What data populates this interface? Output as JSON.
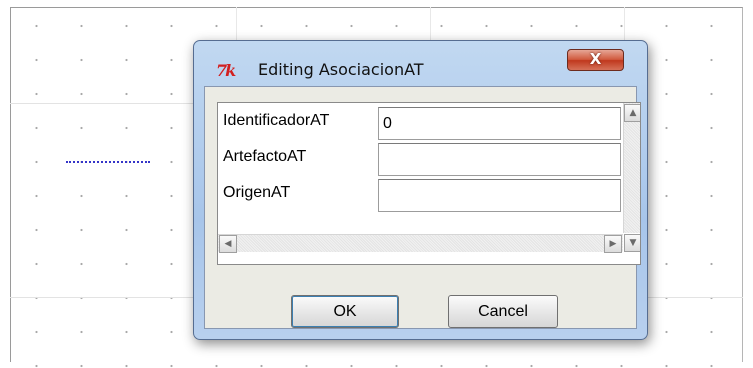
{
  "dialog": {
    "title": "Editing AsociacionAT",
    "app_icon": "7k",
    "close_symbol": "X",
    "fields": [
      {
        "label": "IdentificadorAT",
        "value": "0"
      },
      {
        "label": "ArtefactoAT",
        "value": ""
      },
      {
        "label": "OrigenAT",
        "value": ""
      }
    ],
    "scroll_up": "▲",
    "scroll_down": "▼",
    "scroll_left": "◀",
    "scroll_right": "▶",
    "ok_label": "OK",
    "cancel_label": "Cancel"
  },
  "colors": {
    "association_line": "#3535c8",
    "close_button": "#c8442a",
    "dialog_frame": "#a7c5ea"
  }
}
